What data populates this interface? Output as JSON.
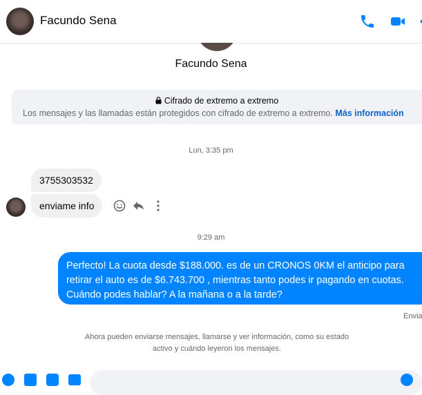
{
  "header": {
    "contact_name": "Facundo Sena",
    "icons": [
      "phone-icon",
      "video-call-icon"
    ],
    "accent_color": "#0084ff"
  },
  "profile": {
    "name": "Facundo Sena"
  },
  "encryption_notice": {
    "title": "Cifrado de extremo a extremo",
    "description": "Los mensajes y las llamadas están protegidos con cifrado de extremo a extremo.",
    "link": "Más información"
  },
  "conversation": {
    "timestamp_1": "Lun, 3:35 pm",
    "incoming": [
      {
        "text": "3755303532"
      },
      {
        "text": "enviame info"
      }
    ],
    "timestamp_2": "9:29 am",
    "outgoing": {
      "line_1": "Perfecto! La cuota desde $188.000. es de un CRONOS 0KM el anticipo para",
      "line_2": "retirar el auto es de $6.743.700 , mientras tanto podes ir pagando en cuotas.",
      "line_3": "Cuándo podes hablar? A la mañana o a la tarde?"
    },
    "sent_status": "Enviado",
    "info_line_1": "Ahora pueden enviarse mensajes, llamarse y ver información, como su estado",
    "info_line_2": "activo y cuándo leyeron los mensajes."
  }
}
